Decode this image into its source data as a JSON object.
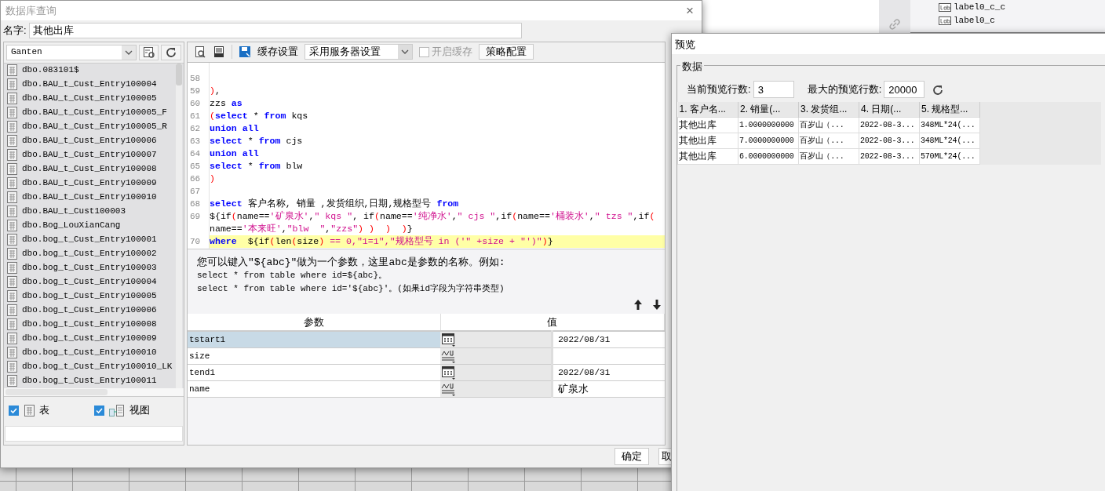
{
  "main_dialog": {
    "title": "数据库查询",
    "close": "×",
    "name_label": "名字:",
    "name_value": "其他出库"
  },
  "connection": {
    "value": "Ganten"
  },
  "tables": [
    {
      "name": "dbo.083101$"
    },
    {
      "name": "dbo.BAU_t_Cust_Entry100004"
    },
    {
      "name": "dbo.BAU_t_Cust_Entry100005"
    },
    {
      "name": "dbo.BAU_t_Cust_Entry100005_F"
    },
    {
      "name": "dbo.BAU_t_Cust_Entry100005_R"
    },
    {
      "name": "dbo.BAU_t_Cust_Entry100006"
    },
    {
      "name": "dbo.BAU_t_Cust_Entry100007"
    },
    {
      "name": "dbo.BAU_t_Cust_Entry100008"
    },
    {
      "name": "dbo.BAU_t_Cust_Entry100009"
    },
    {
      "name": "dbo.BAU_t_Cust_Entry100010"
    },
    {
      "name": "dbo.BAU_t_Cust100003"
    },
    {
      "name": "dbo.Bog_LouXianCang"
    },
    {
      "name": "dbo.bog_t_Cust_Entry100001"
    },
    {
      "name": "dbo.bog_t_Cust_Entry100002"
    },
    {
      "name": "dbo.bog_t_Cust_Entry100003"
    },
    {
      "name": "dbo.bog_t_Cust_Entry100004"
    },
    {
      "name": "dbo.bog_t_Cust_Entry100005"
    },
    {
      "name": "dbo.bog_t_Cust_Entry100006"
    },
    {
      "name": "dbo.bog_t_Cust_Entry100008"
    },
    {
      "name": "dbo.bog_t_Cust_Entry100009"
    },
    {
      "name": "dbo.bog_t_Cust_Entry100010"
    },
    {
      "name": "dbo.bog_t_Cust_Entry100010_LK"
    },
    {
      "name": "dbo.bog_t_Cust_Entry100011"
    }
  ],
  "filters": [
    {
      "label": "表",
      "checked": true,
      "kind": "table"
    },
    {
      "label": "视图",
      "checked": true,
      "kind": "view"
    }
  ],
  "toolbar": {
    "cache_label": "缓存设置",
    "cache_mode": "采用服务器设置",
    "enable_cache": {
      "label": "开启缓存",
      "checked": false,
      "disabled": true
    },
    "strategy_button": "策略配置"
  },
  "code_lines": [
    {
      "number": "58"
    },
    {
      "number": "59",
      "segments": [
        {
          "text": ")",
          "kind": "paren"
        },
        {
          "text": ",",
          "kind": "plain"
        }
      ]
    },
    {
      "number": "60",
      "segments": [
        {
          "text": "zzs ",
          "kind": "plain"
        },
        {
          "text": "as",
          "kind": "kw"
        }
      ]
    },
    {
      "number": "61",
      "segments": [
        {
          "text": "(",
          "kind": "paren"
        },
        {
          "text": "select",
          "kind": "kw"
        },
        {
          "text": " * ",
          "kind": "plain"
        },
        {
          "text": "from",
          "kind": "kw"
        },
        {
          "text": " kqs",
          "kind": "plain"
        }
      ]
    },
    {
      "number": "62",
      "segments": [
        {
          "text": "union all",
          "kind": "kw"
        }
      ]
    },
    {
      "number": "63",
      "segments": [
        {
          "text": "select",
          "kind": "kw"
        },
        {
          "text": " * ",
          "kind": "plain"
        },
        {
          "text": "from",
          "kind": "kw"
        },
        {
          "text": " cjs",
          "kind": "plain"
        }
      ]
    },
    {
      "number": "64",
      "segments": [
        {
          "text": "union all",
          "kind": "kw"
        }
      ]
    },
    {
      "number": "65",
      "segments": [
        {
          "text": "select",
          "kind": "kw"
        },
        {
          "text": " * ",
          "kind": "plain"
        },
        {
          "text": "from",
          "kind": "kw"
        },
        {
          "text": " blw",
          "kind": "plain"
        }
      ]
    },
    {
      "number": "66",
      "segments": [
        {
          "text": ")",
          "kind": "paren"
        }
      ]
    },
    {
      "number": "67"
    },
    {
      "number": "68",
      "segments": [
        {
          "text": "select",
          "kind": "kw"
        },
        {
          "text": " 客户名称, 销量 ,发货组织,日期,规格型号 ",
          "kind": "plain"
        },
        {
          "text": "from",
          "kind": "kw"
        }
      ]
    },
    {
      "number": "69",
      "segments": [
        {
          "text": "${if",
          "kind": "plain"
        },
        {
          "text": "(",
          "kind": "paren"
        },
        {
          "text": "name==",
          "kind": "plain"
        },
        {
          "text": "'矿泉水'",
          "kind": "str"
        },
        {
          "text": ",",
          "kind": "plain"
        },
        {
          "text": "\" kqs \"",
          "kind": "str"
        },
        {
          "text": ", if",
          "kind": "plain"
        },
        {
          "text": "(",
          "kind": "paren"
        },
        {
          "text": "name==",
          "kind": "plain"
        },
        {
          "text": "'纯净水'",
          "kind": "str"
        },
        {
          "text": ",",
          "kind": "plain"
        },
        {
          "text": "\" cjs \"",
          "kind": "str"
        },
        {
          "text": ",if",
          "kind": "plain"
        },
        {
          "text": "(",
          "kind": "paren"
        },
        {
          "text": "name==",
          "kind": "plain"
        },
        {
          "text": "'桶装水'",
          "kind": "str"
        },
        {
          "text": ",",
          "kind": "plain"
        },
        {
          "text": "\" tzs \"",
          "kind": "str"
        },
        {
          "text": ",if",
          "kind": "plain"
        },
        {
          "text": "(",
          "kind": "paren"
        }
      ]
    },
    {
      "segments": [
        {
          "text": "name==",
          "kind": "plain"
        },
        {
          "text": "'本来旺'",
          "kind": "str"
        },
        {
          "text": ",",
          "kind": "plain"
        },
        {
          "text": "\"blw  \"",
          "kind": "str"
        },
        {
          "text": ",",
          "kind": "plain"
        },
        {
          "text": "\"zzs\"",
          "kind": "str"
        },
        {
          "text": ") )  )  )",
          "kind": "paren"
        },
        {
          "text": "}",
          "kind": "plain"
        }
      ]
    },
    {
      "number": "70",
      "highlighted": true,
      "segments": [
        {
          "text": "where",
          "kind": "kw"
        },
        {
          "text": "  ${if",
          "kind": "plain"
        },
        {
          "text": "(",
          "kind": "paren"
        },
        {
          "text": "len",
          "kind": "plain"
        },
        {
          "text": "(",
          "kind": "paren"
        },
        {
          "text": "size",
          "kind": "plain"
        },
        {
          "text": ")",
          "kind": "paren"
        },
        {
          "text": " == 0,\"1=1\",\"规格型号 in ('\" +size + \"')\"",
          "kind": "str"
        },
        {
          "text": ")",
          "kind": "paren"
        },
        {
          "text": "}",
          "kind": "plain"
        }
      ]
    }
  ],
  "hint": [
    "您可以键入\"${abc}\"做为一个参数，这里abc是参数的名称。例如:",
    "select * from table where id=${abc}。",
    "select * from table where id='${abc}'。(如果id字段为字符串类型)"
  ],
  "parameters": {
    "columns": [
      "参数",
      "值"
    ],
    "rows": [
      {
        "name": "tstart1",
        "kind": "date",
        "value": "2022/08/31",
        "selected": true
      },
      {
        "name": "size",
        "kind": "text",
        "selected": false
      },
      {
        "name": "tend1",
        "kind": "date",
        "value": "2022/08/31",
        "selected": false
      },
      {
        "name": "name",
        "kind": "text",
        "value": "矿泉水",
        "selected": false
      }
    ]
  },
  "buttons": [
    "确定",
    "取"
  ],
  "preview": {
    "title": "预览",
    "group": "数据",
    "current_label": "当前预览行数:",
    "current_value": "3",
    "max_label": "最大的预览行数:",
    "max_value": "20000",
    "columns": [
      "1. 客户名...",
      "2. 销量(...",
      "3. 发货组...",
      "4. 日期(...",
      "5. 规格型..."
    ],
    "rows": [
      [
        "其他出库",
        "1.0000000000",
        "百岁山（...",
        "2022-08-3...",
        "348ML*24(..."
      ],
      [
        "其他出库",
        "7.0000000000",
        "百岁山（...",
        "2022-08-3...",
        "348ML*24(..."
      ],
      [
        "其他出库",
        "6.0000000000",
        "百岁山（...",
        "2022-08-3...",
        "570ML*24(..."
      ]
    ]
  },
  "background": {
    "tree_items": [
      "label0_c_c",
      "label0_c"
    ]
  }
}
